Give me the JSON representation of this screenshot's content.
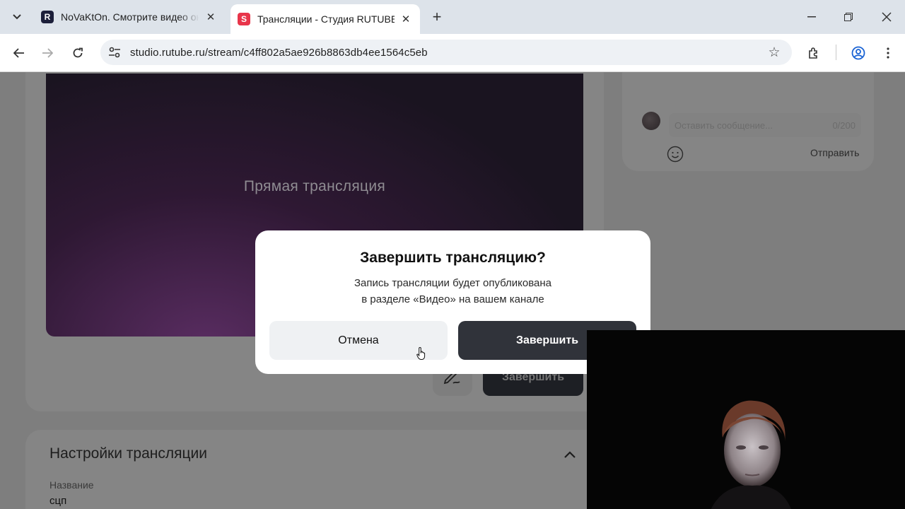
{
  "browser": {
    "tabs": [
      {
        "title": "NoVaKtOn. Смотрите видео онлайн",
        "favicon": "R",
        "active": false
      },
      {
        "title": "Трансляции - Студия RUTUBE",
        "favicon": "S",
        "active": true
      }
    ],
    "url": "studio.rutube.ru/stream/c4ff802a5ae926b8863db4ee1564c5eb"
  },
  "player": {
    "label": "Прямая трансляция"
  },
  "stream_controls": {
    "end_label": "Завершить"
  },
  "chat": {
    "placeholder": "Оставить сообщение...",
    "counter": "0/200",
    "send_label": "Отправить"
  },
  "settings": {
    "title": "Настройки трансляции",
    "name_label": "Название",
    "name_value": "сцп"
  },
  "modal": {
    "title": "Завершить трансляцию?",
    "text_line1": "Запись трансляции будет опубликована",
    "text_line2": "в разделе «Видео» на вашем канале",
    "cancel_label": "Отмена",
    "confirm_label": "Завершить"
  },
  "colors": {
    "overlay": "#7e7e7e",
    "modal_bg": "#ffffff",
    "primary_button": "#30333a",
    "secondary_button": "#eff1f3",
    "rutube_red": "#e8354a"
  }
}
